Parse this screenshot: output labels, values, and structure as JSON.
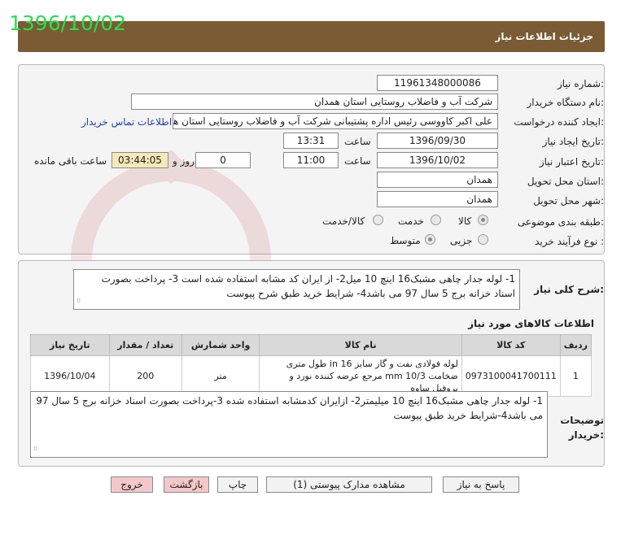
{
  "stamp_date": "1396/10/02",
  "header": {
    "title": "جزئیات اطلاعات نیاز"
  },
  "form": {
    "need_number_label": "شماره نیاز:",
    "need_number": "11961348000086",
    "buyer_org_label": "نام دستگاه خریدار:",
    "buyer_org": "شرکت آب و فاضلاب روستایی استان همدان",
    "creator_label": "ایجاد کننده درخواست:",
    "creator": "علی اکبر  کاووسی رئیس اداره پشتیبانی شرکت آب و فاضلاب روستایی استان همدان",
    "contact_link": "اطلاعات تماس خریدار",
    "created_date_label": "تاریخ ایجاد نیاز:",
    "created_date": "1396/09/30",
    "time_label": "ساعت",
    "created_time": "13:31",
    "valid_date_label": "تاریخ اعتبار نیاز:",
    "valid_date": "1396/10/02",
    "valid_time": "11:00",
    "days": "0",
    "days_label": "روز و",
    "remaining": "03:44:05",
    "remaining_label": "ساعت باقی مانده",
    "province_label": "استان محل تحویل:",
    "province": "همدان",
    "city_label": "شهر محل تحویل:",
    "city": "همدان",
    "category_label": "طبقه بندی موضوعی:",
    "category_options": [
      "کالا",
      "خدمت",
      "کالا/خدمت"
    ],
    "category_selected": "کالا",
    "process_label": "نوع فرآیند خرید :",
    "process_options": [
      "جزیی",
      "متوسط"
    ],
    "process_selected": "متوسط"
  },
  "summary": {
    "label": "شرح کلی نیاز:",
    "text": "1- لوله جدار چاهی مشبک16 اینچ 10 میل2- از ایران کد مشابه استفاده شده است 3- پرداخت بصورت اسناد خزانه برج 5 سال 97 می باشد4- شرایط خرید طبق شرح پیوست"
  },
  "goods": {
    "title": "اطلاعات کالاهای مورد نیاز",
    "columns": [
      "ردیف",
      "کد کالا",
      "نام کالا",
      "واحد شمارش",
      "تعداد / مقدار",
      "تاریخ نیاز"
    ],
    "rows": [
      {
        "row": "1",
        "code": "0973100041700111",
        "name": "لوله فولادی نفت و گاز سایز 16 in طول متری ضخامت 10/3 mm مرجع عرضه کننده نورد و پروفیل ساوه",
        "unit": "متر",
        "qty": "200",
        "date": "1396/10/04"
      }
    ]
  },
  "buyer_notes": {
    "label": "توضیحات خریدار:",
    "text": "1- لوله جدار چاهی مشبک16 اینچ 10 میلیمتر2- ازایران کدمشابه استفاده شده 3-پرداخت بصورت اسناد خزانه برج 5 سال 97 می باشد4-شرایط خرید طبق پیوست"
  },
  "buttons": {
    "reply": "پاسخ به نیاز",
    "view_docs": "مشاهده مدارک پیوستی (1)",
    "print": "چاپ",
    "back": "بازگشت",
    "exit": "خروج"
  }
}
